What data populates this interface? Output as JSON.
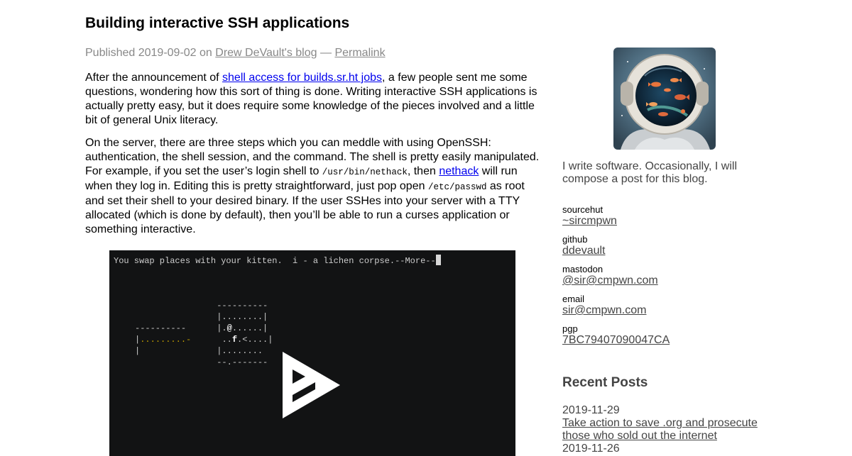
{
  "article": {
    "title": "Building interactive SSH applications",
    "meta": {
      "published_prefix": "Published 2019-09-02 on",
      "blog_link": "Drew DeVault's blog",
      "separator": "—",
      "permalink": "Permalink"
    },
    "p1": {
      "before": "After the announcement of ",
      "link": "shell access for builds.sr.ht jobs",
      "after": ", a few people sent me some questions, wondering how this sort of thing is done. Writing interactive SSH applications is actually pretty easy, but it does require some knowledge of the pieces involved and a little bit of general Unix literacy."
    },
    "p2": {
      "t1": "On the server, there are three steps which you can meddle with using OpenSSH: authentication, the shell session, and the command. The shell is pretty easily manipulated. For example, if you set the user’s login shell to ",
      "code1": "/usr/bin/nethack",
      "t2": ", then ",
      "link": "nethack",
      "t3": " will run when they log in. Editing this is pretty straightforward, just pop open ",
      "code2": "/etc/passwd",
      "t4": " as root and set their shell to your desired binary. If the user SSHes into your server with a TTY allocated (which is done by default), then you’ll be able to run a curses application or something interactive."
    }
  },
  "terminal": {
    "status_line": "You swap places with your kitten.  i - a lichen corpse.--More--",
    "map": {
      "r1a": "                     ----------",
      "r2a": "                     |........|",
      "r3a": "     ----------      |.",
      "r3b": "@",
      "r3c": "......|",
      "r4a": "     |",
      "r4b": ".........-",
      "r4c": "      ..",
      "r4d": "f",
      "r4e": ".<....|",
      "r5a": "     |               |........",
      "r6a": "                     --.-------"
    }
  },
  "sidebar": {
    "bio": "I write software. Occasionally, I will compose a post for this blog.",
    "links": [
      {
        "label": "sourcehut",
        "value": "~sircmpwn"
      },
      {
        "label": "github",
        "value": "ddevault"
      },
      {
        "label": "mastodon",
        "value": "@sir@cmpwn.com"
      },
      {
        "label": "email",
        "value": "sir@cmpwn.com"
      },
      {
        "label": "pgp",
        "value": "7BC79407090047CA"
      }
    ],
    "recent_title": "Recent Posts",
    "recent_posts": [
      {
        "date": "2019-11-29",
        "title": "Take action to save .org and prosecute those who sold out the internet"
      },
      {
        "date": "2019-11-26",
        "title": ""
      }
    ]
  },
  "colors": {
    "link": "#0000ee",
    "meta": "#888888",
    "sidebar_text": "#444444",
    "terminal_bg": "#121314",
    "terminal_text": "#cccccc",
    "terminal_highlight": "#c4a000"
  },
  "icons": {
    "play": "asciinema-play-icon",
    "avatar": "astronaut-avatar"
  }
}
